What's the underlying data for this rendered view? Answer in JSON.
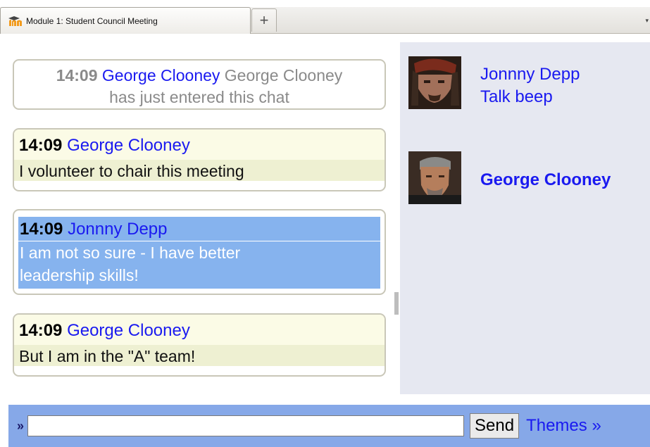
{
  "browser": {
    "tab_title": "Module 1: Student Council Meeting",
    "new_tab_label": "+",
    "favicon": "moodle-logo-icon"
  },
  "chat": {
    "system_message": {
      "time": "14:09",
      "user": "George Clooney",
      "text_line1": "George Clooney",
      "text_line2": "has just entered this chat"
    },
    "messages": [
      {
        "time": "14:09",
        "user": "George Clooney",
        "text": "I volunteer to chair this meeting"
      },
      {
        "time": "14:09",
        "user": "Jonnny Depp",
        "text_line1": "I am not so sure - I have better",
        "text_line2": "leadership skills!"
      },
      {
        "time": "14:09",
        "user": "George Clooney",
        "text": "But I am in the \"A\" team!"
      }
    ]
  },
  "users": [
    {
      "name": "Jonnny Depp",
      "action": "Talk beep",
      "avatar": "pirate-avatar"
    },
    {
      "name": "George Clooney",
      "avatar": "man-avatar"
    }
  ],
  "input": {
    "prompt": "»",
    "value": "",
    "send_label": "Send",
    "themes_label": "Themes »"
  },
  "colors": {
    "link": "#1a1af0",
    "highlight": "#86b3ee",
    "users_bg": "#e6e8f1",
    "input_bar": "#86a8e8"
  }
}
